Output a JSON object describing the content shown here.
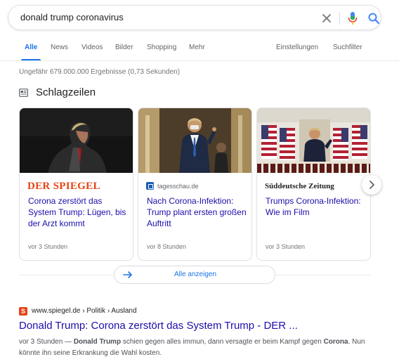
{
  "search": {
    "query": "donald trump coronavirus"
  },
  "tabs": [
    {
      "label": "Alle",
      "active": true
    },
    {
      "label": "News"
    },
    {
      "label": "Videos"
    },
    {
      "label": "Bilder"
    },
    {
      "label": "Shopping"
    },
    {
      "label": "Mehr"
    }
  ],
  "tools": {
    "settings": "Einstellungen",
    "filters": "Suchfilter"
  },
  "stats": "Ungefähr 679.000.000 Ergebnisse (0,73 Sekunden)",
  "headlines": {
    "title": "Schlagzeilen",
    "cards": [
      {
        "source": "DER SPIEGEL",
        "headline": "Corona zerstört das System Trump: Lügen, bis der Arzt kommt",
        "time": "vor 3 Stunden"
      },
      {
        "source": "tagesschau.de",
        "headline": "Nach Corona-Infektion: Trump plant ersten großen Auftritt",
        "time": "vor 8 Stunden"
      },
      {
        "source": "Süddeutsche Zeitung",
        "headline": "Trumps Corona-Infektion: Wie im Film",
        "time": "vor 3 Stunden"
      }
    ],
    "show_all": "Alle anzeigen"
  },
  "result": {
    "favicon_letter": "S",
    "breadcrumb": "www.spiegel.de › Politik › Ausland",
    "title": "Donald Trump: Corona zerstört das System Trump - DER ...",
    "snippet": {
      "time": "vor 3 Stunden",
      "dash": " — ",
      "b1": "Donald Trump",
      "t1": " schien gegen alles immun, dann versagte er beim Kampf gegen ",
      "b2": "Corona",
      "t2": ". Nun könnte ihn seine Erkrankung die Wahl kosten."
    }
  },
  "colors": {
    "link": "#1a0dab",
    "accent": "#1a73e8",
    "spiegel": "#e64415",
    "meta": "#70757a"
  }
}
